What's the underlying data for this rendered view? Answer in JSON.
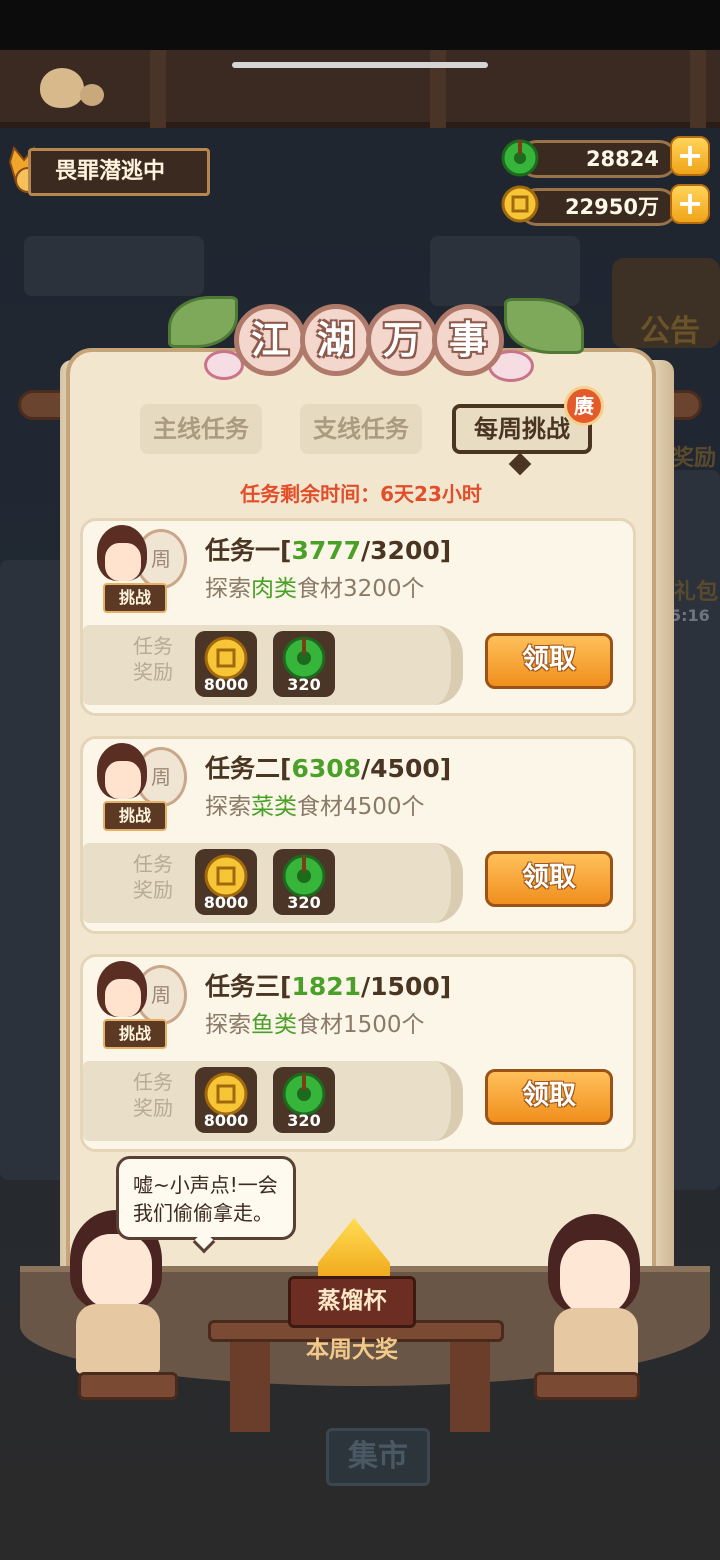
{
  "hud": {
    "status": "畏罪潜逃中",
    "jade": "28824",
    "coins": "22950万",
    "plus": "+"
  },
  "panel": {
    "title_chars": [
      "江",
      "湖",
      "万",
      "事"
    ],
    "tabs": [
      {
        "label": "主线任务",
        "active": false
      },
      {
        "label": "支线任务",
        "active": false
      },
      {
        "label": "每周挑战",
        "active": true
      }
    ],
    "tab_badge": "赓",
    "time_left": "任务剩余时间：6天23小时"
  },
  "tasks": [
    {
      "title_prefix": "任务一[",
      "current": "3777",
      "target_suffix": "/3200]",
      "desc_prefix": "探索",
      "kind": "肉类",
      "desc_suffix": "食材3200个",
      "avatar_badge": "周",
      "tag": "挑战",
      "reward_label": "任务奖励",
      "reward_coin": "8000",
      "reward_jade": "320",
      "claim": "领取"
    },
    {
      "title_prefix": "任务二[",
      "current": "6308",
      "target_suffix": "/4500]",
      "desc_prefix": "探索",
      "kind": "菜类",
      "desc_suffix": "食材4500个",
      "avatar_badge": "周",
      "tag": "挑战",
      "reward_label": "任务奖励",
      "reward_coin": "8000",
      "reward_jade": "320",
      "claim": "领取"
    },
    {
      "title_prefix": "任务三[",
      "current": "1821",
      "target_suffix": "/1500]",
      "desc_prefix": "探索",
      "kind": "鱼类",
      "desc_suffix": "食材1500个",
      "avatar_badge": "周",
      "tag": "挑战",
      "reward_label": "任务奖励",
      "reward_coin": "8000",
      "reward_jade": "320",
      "claim": "领取"
    }
  ],
  "scene": {
    "speech": "嘘~小声点!一会我们偷偷拿走。",
    "trophy_name": "蒸馏杯",
    "weekly_prize": "本周大奖"
  },
  "background": {
    "notice": "公告",
    "reward_hint": "奖励",
    "gift_hint": "礼包",
    "timer_hint": "5:16",
    "market": "集市"
  },
  "colors": {
    "progress_green": "#4aa028",
    "time_red": "#e24e2a",
    "claim_orange": "#f5a536",
    "panel_bg": "#f2e6cf"
  }
}
